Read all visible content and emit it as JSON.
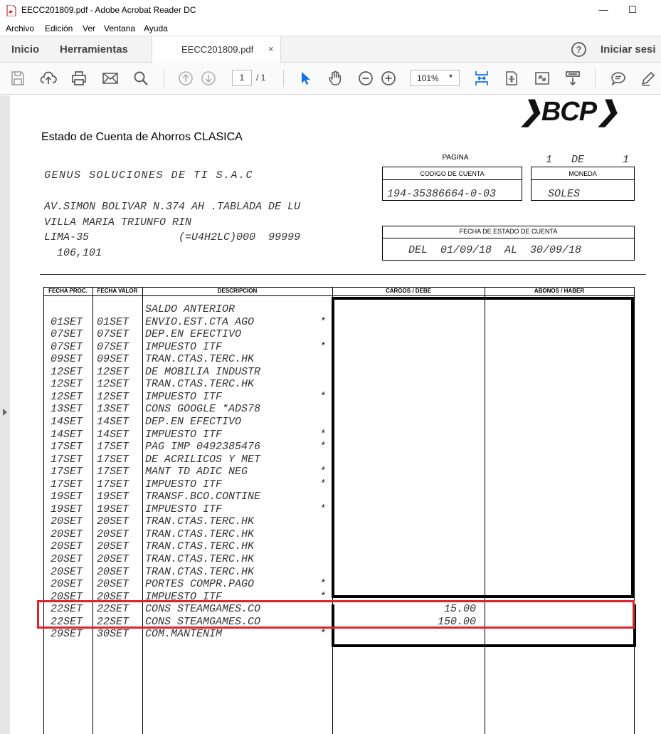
{
  "window": {
    "title": "EECC201809.pdf - Adobe Acrobat Reader DC",
    "minimize": "—",
    "maximize": "☐"
  },
  "menu": [
    "Archivo",
    "Edición",
    "Ver",
    "Ventana",
    "Ayuda"
  ],
  "tabs": {
    "home": "Inicio",
    "tools": "Herramientas",
    "document": "EECC201809.pdf",
    "close": "×",
    "help": "?",
    "signin": "Iniciar sesi"
  },
  "toolbar": {
    "page_current": "1",
    "page_total": "/ 1",
    "zoom": "101%",
    "zoom_caret": "▾",
    "icons": [
      "save-icon",
      "upload-icon",
      "print-icon",
      "mail-icon",
      "search-icon",
      "page-up-icon",
      "page-down-icon",
      "select-cursor-icon",
      "hand-icon",
      "zoom-out-icon",
      "zoom-in-icon",
      "fit-page-icon",
      "rotate-icon",
      "fullscreen-icon",
      "read-mode-icon",
      "comment-icon",
      "highlight-icon"
    ]
  },
  "statement": {
    "logo": "❯BCP❯",
    "title": "Estado de Cuenta de Ahorros CLASICA",
    "company": "GENUS SOLUCIONES DE TI S.A.C",
    "address": [
      "AV.SIMON BOLIVAR N.374 AH .TABLADA DE LU",
      "VILLA MARIA TRIUNFO RIN",
      "LIMA-35              (=U4H2LC)000  99999",
      "  106,101"
    ],
    "pagina_label": "PAGINA",
    "pagina_value": "1   DE      1",
    "account_label": "CODIGO DE CUENTA",
    "account_value": "194-35386664-0-03",
    "currency_label": "MONEDA",
    "currency_value": "SOLES",
    "period_label": "FECHA DE ESTADO DE CUENTA",
    "period_value": "DEL  01/09/18  AL  30/09/18",
    "columns": [
      "FECHA PROC.",
      "FECHA VALOR",
      "DESCRIPCION",
      "CARGOS / DEBE",
      "ABONOS / HABER"
    ],
    "rows": [
      {
        "proc": "",
        "valor": "",
        "desc": "SALDO ANTERIOR",
        "flag": "",
        "debe": ""
      },
      {
        "proc": "01SET",
        "valor": "01SET",
        "desc": "ENVIO.EST.CTA AGO",
        "flag": "*",
        "debe": ""
      },
      {
        "proc": "07SET",
        "valor": "07SET",
        "desc": "DEP.EN EFECTIVO",
        "flag": "",
        "debe": ""
      },
      {
        "proc": "07SET",
        "valor": "07SET",
        "desc": "IMPUESTO ITF",
        "flag": "*",
        "debe": ""
      },
      {
        "proc": "09SET",
        "valor": "09SET",
        "desc": "TRAN.CTAS.TERC.HK",
        "flag": "",
        "debe": ""
      },
      {
        "proc": "12SET",
        "valor": "12SET",
        "desc": "DE MOBILIA INDUSTR",
        "flag": "",
        "debe": ""
      },
      {
        "proc": "12SET",
        "valor": "12SET",
        "desc": "TRAN.CTAS.TERC.HK",
        "flag": "",
        "debe": ""
      },
      {
        "proc": "12SET",
        "valor": "12SET",
        "desc": "IMPUESTO ITF",
        "flag": "*",
        "debe": ""
      },
      {
        "proc": "13SET",
        "valor": "13SET",
        "desc": "CONS GOOGLE *ADS78",
        "flag": "",
        "debe": ""
      },
      {
        "proc": "14SET",
        "valor": "14SET",
        "desc": "DEP.EN EFECTIVO",
        "flag": "",
        "debe": ""
      },
      {
        "proc": "14SET",
        "valor": "14SET",
        "desc": "IMPUESTO ITF",
        "flag": "*",
        "debe": ""
      },
      {
        "proc": "17SET",
        "valor": "17SET",
        "desc": "PAG IMP 0492385476",
        "flag": "*",
        "debe": ""
      },
      {
        "proc": "17SET",
        "valor": "17SET",
        "desc": "DE ACRILICOS Y MET",
        "flag": "",
        "debe": ""
      },
      {
        "proc": "17SET",
        "valor": "17SET",
        "desc": "MANT TD ADIC NEG",
        "flag": "*",
        "debe": ""
      },
      {
        "proc": "17SET",
        "valor": "17SET",
        "desc": "IMPUESTO ITF",
        "flag": "*",
        "debe": ""
      },
      {
        "proc": "19SET",
        "valor": "19SET",
        "desc": "TRANSF.BCO.CONTINE",
        "flag": "",
        "debe": ""
      },
      {
        "proc": "19SET",
        "valor": "19SET",
        "desc": "IMPUESTO ITF",
        "flag": "*",
        "debe": ""
      },
      {
        "proc": "20SET",
        "valor": "20SET",
        "desc": "TRAN.CTAS.TERC.HK",
        "flag": "",
        "debe": ""
      },
      {
        "proc": "20SET",
        "valor": "20SET",
        "desc": "TRAN.CTAS.TERC.HK",
        "flag": "",
        "debe": ""
      },
      {
        "proc": "20SET",
        "valor": "20SET",
        "desc": "TRAN.CTAS.TERC.HK",
        "flag": "",
        "debe": ""
      },
      {
        "proc": "20SET",
        "valor": "20SET",
        "desc": "TRAN.CTAS.TERC.HK",
        "flag": "",
        "debe": ""
      },
      {
        "proc": "20SET",
        "valor": "20SET",
        "desc": "TRAN.CTAS.TERC.HK",
        "flag": "",
        "debe": ""
      },
      {
        "proc": "20SET",
        "valor": "20SET",
        "desc": "PORTES COMPR.PAGO",
        "flag": "*",
        "debe": ""
      },
      {
        "proc": "20SET",
        "valor": "20SET",
        "desc": "IMPUESTO ITF",
        "flag": "*",
        "debe": ""
      },
      {
        "proc": "22SET",
        "valor": "22SET",
        "desc": "CONS STEAMGAMES.CO",
        "flag": "",
        "debe": "15.00"
      },
      {
        "proc": "22SET",
        "valor": "22SET",
        "desc": "CONS STEAMGAMES.CO",
        "flag": "",
        "debe": "150.00"
      },
      {
        "proc": "29SET",
        "valor": "30SET",
        "desc": "COM.MANTENIM",
        "flag": "*",
        "debe": ""
      }
    ]
  },
  "colors": {
    "highlight": "#e0232b",
    "redaction": "#000000",
    "toolbar_icon": "#5a5a5a",
    "accent_icon": "#1473e6"
  }
}
